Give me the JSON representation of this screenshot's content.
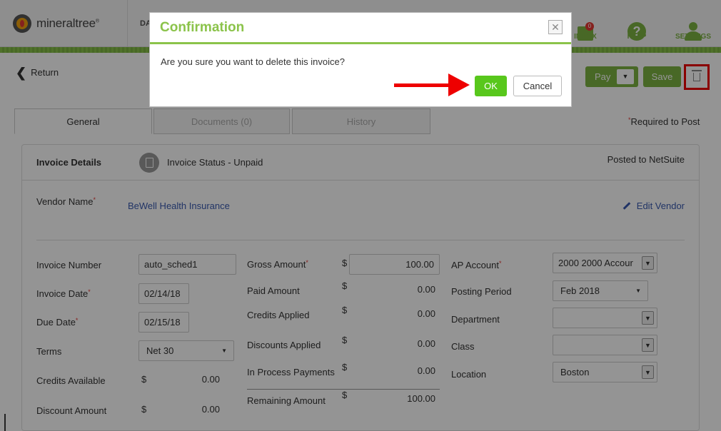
{
  "nav": {
    "logo_text": "mineraltree",
    "logo_mark": "®",
    "dashboard_abbrev": "DA",
    "inbox_label": "INBOX",
    "inbox_count": "0",
    "help_label": "HELP",
    "help_glyph": "?",
    "settings_label": "SETTINGS"
  },
  "actions": {
    "return_label": "Return",
    "return_glyph": "❮",
    "pay_label": "Pay",
    "save_label": "Save",
    "dropdown_glyph": "▼"
  },
  "tabs": [
    {
      "label": "General",
      "active": true
    },
    {
      "label": "Documents (0)",
      "active": false
    },
    {
      "label": "History",
      "active": false
    }
  ],
  "required_note": "Required to Post",
  "invoice": {
    "section_title": "Invoice Details",
    "status": "Invoice Status - Unpaid",
    "posted": "Posted to NetSuite",
    "vendor_label": "Vendor Name",
    "vendor_value": "BeWell Health Insurance",
    "edit_vendor": "Edit Vendor",
    "left": {
      "invoice_number_label": "Invoice Number",
      "invoice_number_value": "auto_sched1",
      "invoice_date_label": "Invoice Date",
      "invoice_date_value": "02/14/18",
      "due_date_label": "Due Date",
      "due_date_value": "02/15/18",
      "terms_label": "Terms",
      "terms_value": "Net 30",
      "credits_available_label": "Credits Available",
      "credits_available_value": "0.00",
      "discount_amount_label": "Discount Amount",
      "discount_amount_value": "0.00"
    },
    "middle": {
      "gross_amount_label": "Gross Amount",
      "gross_amount_value": "100.00",
      "paid_amount_label": "Paid Amount",
      "paid_amount_value": "0.00",
      "credits_applied_label": "Credits Applied",
      "credits_applied_value": "0.00",
      "discounts_applied_label": "Discounts Applied",
      "discounts_applied_value": "0.00",
      "in_process_label": "In Process Payments",
      "in_process_value": "0.00",
      "remaining_label": "Remaining Amount",
      "remaining_value": "100.00"
    },
    "right": {
      "ap_account_label": "AP Account",
      "ap_account_value": "2000 2000 Accour",
      "posting_period_label": "Posting Period",
      "posting_period_value": "Feb 2018",
      "department_label": "Department",
      "department_value": "",
      "class_label": "Class",
      "class_value": "",
      "location_label": "Location",
      "location_value": "Boston"
    },
    "currency_symbol": "$",
    "required_star": "*"
  },
  "dialog": {
    "title": "Confirmation",
    "message": "Are you sure you want to delete this invoice?",
    "ok_label": "OK",
    "cancel_label": "Cancel",
    "close_glyph": "✕"
  },
  "colors": {
    "brand_green": "#7cb342",
    "ok_green": "#58c71c",
    "highlight_red": "#e00000",
    "link_blue": "#3a5bb0"
  }
}
